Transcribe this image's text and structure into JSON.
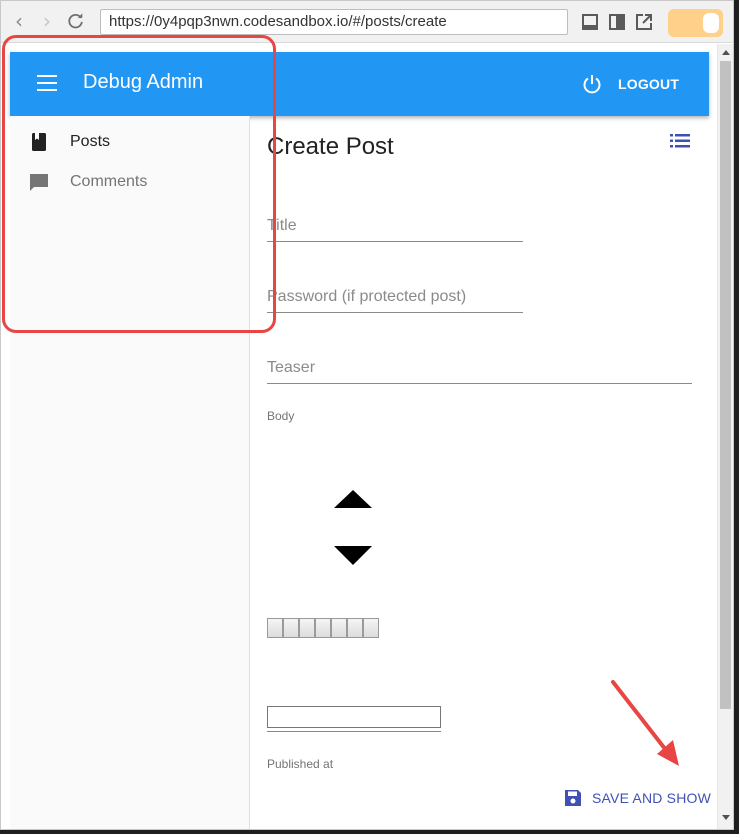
{
  "browser": {
    "url": "https://0y4pqp3nwn.codesandbox.io/#/posts/create",
    "icons": [
      "back-icon",
      "forward-icon",
      "reload-icon",
      "minimize-panel-icon",
      "split-panel-icon",
      "open-external-icon",
      "toggle-switch"
    ],
    "toggle_color": "#ffd08a"
  },
  "appbar": {
    "title": "Debug Admin",
    "logout_label": "LOGOUT",
    "color": "#2196f3"
  },
  "sidebar": {
    "items": [
      {
        "label": "Posts",
        "icon": "book-icon",
        "active": true
      },
      {
        "label": "Comments",
        "icon": "chat-bubble-icon",
        "active": false
      }
    ]
  },
  "form": {
    "title": "Create Post",
    "fields": {
      "title_label": "Title",
      "password_label": "Password (if protected post)",
      "teaser_label": "Teaser",
      "body_label": "Body",
      "published_label": "Published at"
    },
    "save_label": "SAVE AND SHOW",
    "accent_color": "#3f51b5"
  },
  "annotation_color": "#e84545"
}
